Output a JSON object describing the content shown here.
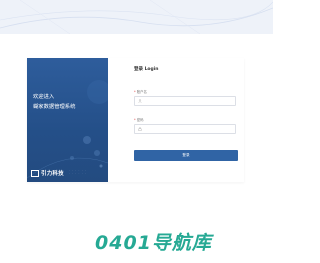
{
  "brand": {
    "welcome_line1": "欢迎进入",
    "welcome_line2": "蝴家数据管理系统",
    "logo_text": "引力科技",
    "colors": {
      "panel": "#2a5893",
      "accent": "#3064a5"
    }
  },
  "login": {
    "title": "登录 Login",
    "username_label": "账户名",
    "username_icon": "user-icon",
    "password_label": "密码",
    "password_icon": "lock-icon",
    "submit_label": "登录"
  },
  "watermark": {
    "text": "0401导航库",
    "color": "#1ba58f"
  }
}
